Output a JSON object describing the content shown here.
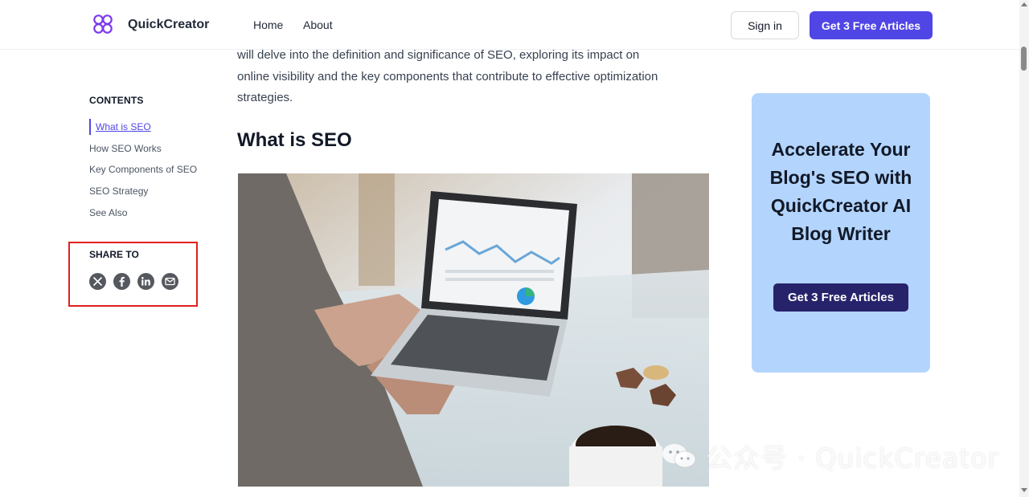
{
  "header": {
    "brand": "QuickCreator",
    "nav": [
      "Home",
      "About"
    ],
    "signin_label": "Sign in",
    "cta_label": "Get 3 Free Articles",
    "colors": {
      "accent": "#5046e5",
      "logo": "#7c3aed"
    }
  },
  "toc": {
    "heading": "CONTENTS",
    "items": [
      {
        "label": "What is SEO",
        "active": true
      },
      {
        "label": "How SEO Works",
        "active": false
      },
      {
        "label": "Key Components of SEO",
        "active": false
      },
      {
        "label": "SEO Strategy",
        "active": false
      },
      {
        "label": "See Also",
        "active": false
      }
    ]
  },
  "share": {
    "heading": "SHARE TO",
    "icons": [
      "x-icon",
      "facebook-icon",
      "linkedin-icon",
      "email-icon"
    ],
    "highlight_color": "#e02020"
  },
  "article": {
    "intro_line1": "will delve into the definition and significance of SEO, exploring its impact on",
    "intro_line2": "online visibility and the key components that contribute to effective optimization",
    "intro_line3": "strategies.",
    "heading": "What is SEO"
  },
  "ad": {
    "title": "Accelerate Your Blog's SEO with QuickCreator AI Blog Writer",
    "button_label": "Get 3 Free Articles",
    "background": "#b3d5fd",
    "button_color": "#27236b"
  },
  "watermark": {
    "text": "公众号 · QuickCreator"
  }
}
